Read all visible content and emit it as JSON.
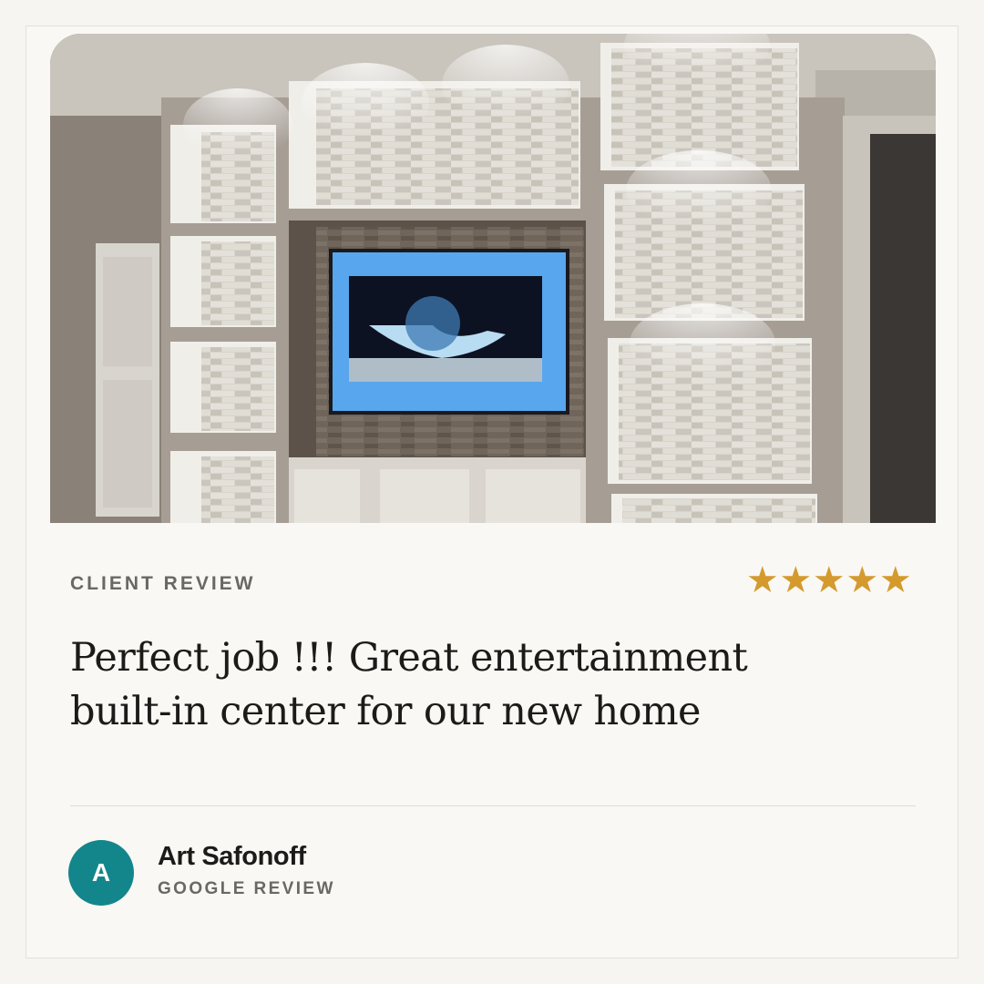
{
  "review": {
    "eyebrow": "CLIENT REVIEW",
    "rating": 5,
    "stars": [
      "★",
      "★",
      "★",
      "★",
      "★"
    ],
    "quote": "Perfect job !!! Great entertainment built-in center for our new home",
    "reviewer": {
      "initial": "A",
      "name": "Art Safonoff",
      "source": "GOOGLE REVIEW"
    }
  },
  "colors": {
    "star": "#d49a2e",
    "avatar": "#13868c",
    "background": "#f9f8f4"
  },
  "photo": {
    "subject": "built-in entertainment center with stacked white stone niches and wall-mounted TV"
  }
}
